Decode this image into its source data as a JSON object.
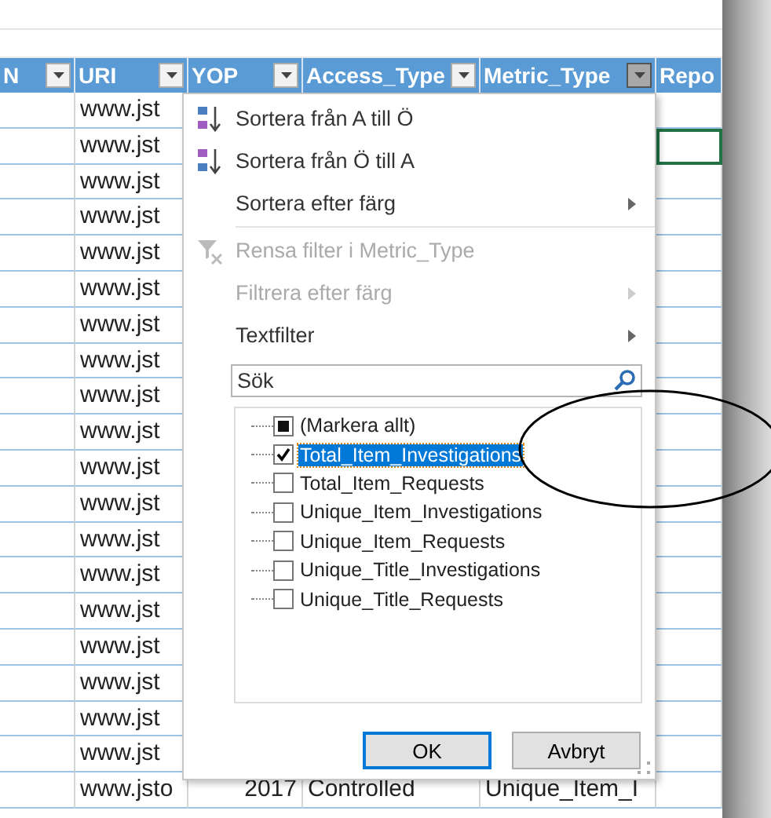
{
  "columns": [
    {
      "label": "N",
      "has_filter": true,
      "active": false
    },
    {
      "label": "URI",
      "has_filter": true,
      "active": false
    },
    {
      "label": "YOP",
      "has_filter": true,
      "active": false
    },
    {
      "label": "Access_Type",
      "has_filter": true,
      "active": false
    },
    {
      "label": "Metric_Type",
      "has_filter": true,
      "active": true
    },
    {
      "label": "Repo",
      "has_filter": false
    }
  ],
  "rows": [
    {
      "cells": [
        "",
        "www.jst",
        "",
        "",
        "",
        ""
      ],
      "last_cell_selected": false
    },
    {
      "cells": [
        "",
        "www.jst",
        "",
        "",
        "",
        ""
      ],
      "last_cell_selected": true
    },
    {
      "cells": [
        "",
        "www.jst",
        "",
        "",
        "",
        ""
      ],
      "last_cell_selected": false
    },
    {
      "cells": [
        "",
        "www.jst",
        "",
        "",
        "",
        ""
      ],
      "last_cell_selected": false
    },
    {
      "cells": [
        "",
        "www.jst",
        "",
        "",
        "",
        ""
      ],
      "last_cell_selected": false
    },
    {
      "cells": [
        "",
        "www.jst",
        "",
        "",
        "",
        ""
      ],
      "last_cell_selected": false
    },
    {
      "cells": [
        "",
        "www.jst",
        "",
        "",
        "",
        ""
      ],
      "last_cell_selected": false
    },
    {
      "cells": [
        "",
        "www.jst",
        "",
        "",
        "",
        ""
      ],
      "last_cell_selected": false
    },
    {
      "cells": [
        "",
        "www.jst",
        "",
        "",
        "",
        ""
      ],
      "last_cell_selected": false
    },
    {
      "cells": [
        "",
        "www.jst",
        "",
        "",
        "",
        ""
      ],
      "last_cell_selected": false
    },
    {
      "cells": [
        "",
        "www.jst",
        "",
        "",
        "",
        ""
      ],
      "last_cell_selected": false
    },
    {
      "cells": [
        "",
        "www.jst",
        "",
        "",
        "",
        ""
      ],
      "last_cell_selected": false
    },
    {
      "cells": [
        "",
        "www.jst",
        "",
        "",
        "",
        ""
      ],
      "last_cell_selected": false
    },
    {
      "cells": [
        "",
        "www.jst",
        "",
        "",
        "",
        ""
      ],
      "last_cell_selected": false
    },
    {
      "cells": [
        "",
        "www.jst",
        "",
        "",
        "",
        ""
      ],
      "last_cell_selected": false
    },
    {
      "cells": [
        "",
        "www.jst",
        "",
        "",
        "",
        ""
      ],
      "last_cell_selected": false
    },
    {
      "cells": [
        "",
        "www.jst",
        "",
        "",
        "",
        ""
      ],
      "last_cell_selected": false
    },
    {
      "cells": [
        "",
        "www.jst",
        "",
        "",
        "",
        ""
      ],
      "last_cell_selected": false
    },
    {
      "cells": [
        "",
        "www.jst",
        "",
        "",
        "",
        ""
      ],
      "last_cell_selected": false
    },
    {
      "cells": [
        "",
        "www.jsto",
        "2017",
        "Controlled",
        "Unique_Item_I",
        ""
      ],
      "last_cell_selected": false
    }
  ],
  "menu": {
    "items": [
      {
        "kind": "sort_asc",
        "label": "Sortera från A till Ö",
        "disabled": false,
        "submenu": false
      },
      {
        "kind": "sort_desc",
        "label": "Sortera från Ö till A",
        "disabled": false,
        "submenu": false
      },
      {
        "kind": "plain",
        "label": "Sortera efter färg",
        "disabled": false,
        "submenu": true
      },
      {
        "kind": "separator"
      },
      {
        "kind": "clear_filter",
        "label": "Rensa filter i Metric_Type",
        "disabled": true,
        "submenu": false
      },
      {
        "kind": "plain",
        "label": "Filtrera efter färg",
        "disabled": true,
        "submenu": true
      },
      {
        "kind": "plain",
        "label": "Textfilter",
        "disabled": false,
        "submenu": true
      }
    ],
    "search": {
      "placeholder": "Sök"
    },
    "values": [
      {
        "label": "(Markera allt)",
        "checked": false,
        "indeterminate": true,
        "selected": false
      },
      {
        "label": "Total_Item_Investigations",
        "checked": true,
        "indeterminate": false,
        "selected": true
      },
      {
        "label": "Total_Item_Requests",
        "checked": false,
        "indeterminate": false,
        "selected": false
      },
      {
        "label": "Unique_Item_Investigations",
        "checked": false,
        "indeterminate": false,
        "selected": false
      },
      {
        "label": "Unique_Item_Requests",
        "checked": false,
        "indeterminate": false,
        "selected": false
      },
      {
        "label": "Unique_Title_Investigations",
        "checked": false,
        "indeterminate": false,
        "selected": false
      },
      {
        "label": "Unique_Title_Requests",
        "checked": false,
        "indeterminate": false,
        "selected": false
      }
    ],
    "buttons": [
      {
        "label": "OK",
        "default": true
      },
      {
        "label": "Avbryt",
        "default": false
      }
    ]
  }
}
